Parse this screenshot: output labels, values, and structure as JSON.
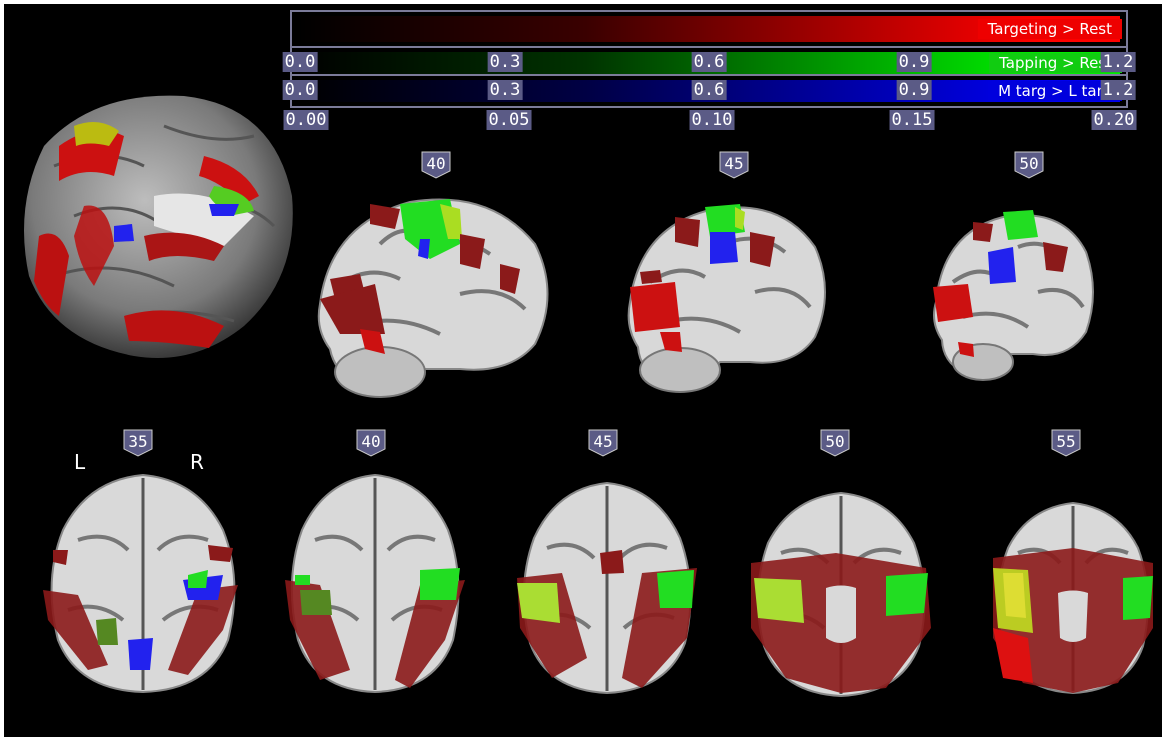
{
  "colorbars": [
    {
      "label": "Targeting > Rest",
      "color": "#ff0000",
      "label_bg": "#ee0000",
      "ticks": [
        "0.0",
        "0.3",
        "0.6",
        "0.9",
        "1.2"
      ]
    },
    {
      "label": "Tapping > Rest",
      "color": "#00dd00",
      "label_bg": "#11cc11",
      "ticks": [
        "0.0",
        "0.3",
        "0.6",
        "0.9",
        "1.2"
      ]
    },
    {
      "label": "M targ > L targ",
      "color": "#0000ff",
      "label_bg": "#0000dd",
      "ticks": [
        "0.00",
        "0.05",
        "0.10",
        "0.15",
        "0.20"
      ]
    }
  ],
  "sagittal_slices": [
    "40",
    "45",
    "50"
  ],
  "axial_slices": [
    "35",
    "40",
    "45",
    "50",
    "55"
  ],
  "orientation": {
    "left": "L",
    "right": "R"
  }
}
